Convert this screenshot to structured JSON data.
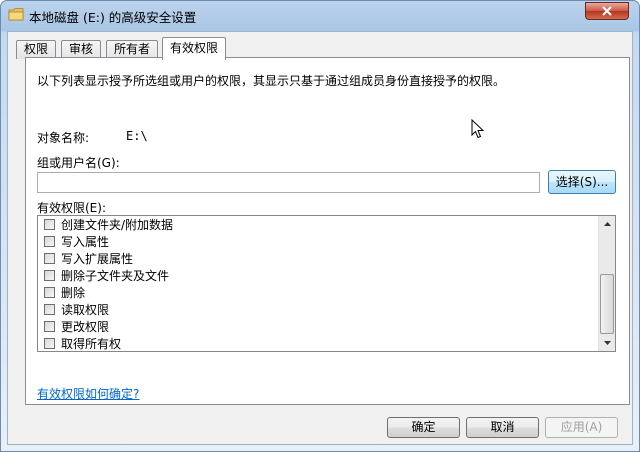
{
  "window": {
    "title": "本地磁盘 (E:) 的高级安全设置",
    "close_icon": "close-icon"
  },
  "tabs": [
    {
      "label": "权限"
    },
    {
      "label": "审核"
    },
    {
      "label": "所有者"
    },
    {
      "label": "有效权限"
    }
  ],
  "active_tab": "有效权限",
  "description": "以下列表显示授予所选组或用户的权限，其显示只基于通过组成员身份直接授予的权限。",
  "object": {
    "label": "对象名称:",
    "value": "E:\\"
  },
  "user_group": {
    "label": "组或用户名(G):",
    "value": "",
    "select_button": "选择(S)..."
  },
  "effective_permissions": {
    "label": "有效权限(E):",
    "items": [
      {
        "label": "创建文件夹/附加数据",
        "checked": false
      },
      {
        "label": "写入属性",
        "checked": false
      },
      {
        "label": "写入扩展属性",
        "checked": false
      },
      {
        "label": "删除子文件夹及文件",
        "checked": false
      },
      {
        "label": "删除",
        "checked": false
      },
      {
        "label": "读取权限",
        "checked": false
      },
      {
        "label": "更改权限",
        "checked": false
      },
      {
        "label": "取得所有权",
        "checked": false
      }
    ]
  },
  "help_link": "有效权限如何确定?",
  "buttons": {
    "ok": "确定",
    "cancel": "取消",
    "apply": "应用(A)"
  },
  "colors": {
    "link": "#0066cc",
    "close_button": "#c95a45",
    "title_bar": "#a9c6e6"
  }
}
